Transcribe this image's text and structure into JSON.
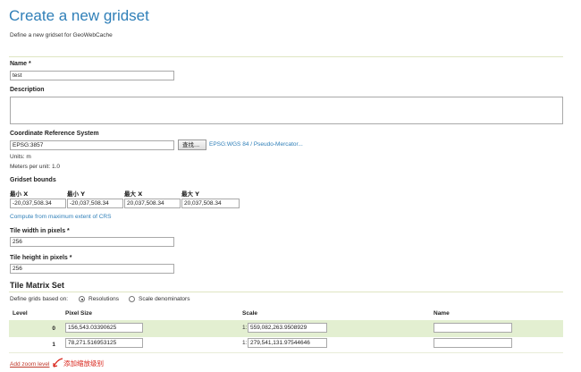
{
  "header": {
    "title": "Create a new gridset",
    "subtitle": "Define a new gridset for GeoWebCache"
  },
  "name": {
    "label": "Name *",
    "value": "test"
  },
  "description": {
    "label": "Description",
    "value": ""
  },
  "crs": {
    "label": "Coordinate Reference System",
    "value": "EPSG:3857",
    "find_button": "查找...",
    "link": "EPSG:WGS 84 / Pseudo-Mercator...",
    "units": "Units: m",
    "meters_per_unit": "Meters per unit: 1.0"
  },
  "bounds": {
    "label": "Gridset bounds",
    "headers": [
      "最小 X",
      "最小 Y",
      "最大 X",
      "最大 Y"
    ],
    "values": [
      "-20,037,508.34",
      "-20,037,508.34",
      "20,037,508.34",
      "20,037,508.34"
    ],
    "compute_link": "Compute from maximum extent of CRS"
  },
  "tile_width": {
    "label": "Tile width in pixels *",
    "value": "256"
  },
  "tile_height": {
    "label": "Tile height in pixels *",
    "value": "256"
  },
  "matrix": {
    "title": "Tile Matrix Set",
    "define_label": "Define grids based on:",
    "option_resolutions": "Resolutions",
    "option_scale": "Scale denominators",
    "selected": "Resolutions",
    "columns": [
      "Level",
      "Pixel Size",
      "Scale",
      "Name"
    ],
    "rows": [
      {
        "level": "0",
        "pixel_size": "156,543.03390625",
        "scale_prefix": "1:",
        "scale": "559,082,263.9508929",
        "name": ""
      },
      {
        "level": "1",
        "pixel_size": "78,271.516953125",
        "scale_prefix": "1:",
        "scale": "279,541,131.97544646",
        "name": ""
      }
    ],
    "add_zoom_link": "Add zoom level",
    "annotation": "添加缩放级别"
  },
  "colors": {
    "title": "#2f7fb8",
    "link": "#2f7fb8",
    "row_highlight": "#e3efd1",
    "annotation": "#d9261c"
  }
}
